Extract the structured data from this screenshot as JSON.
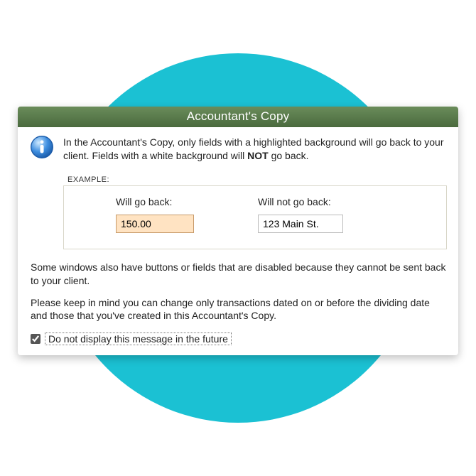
{
  "dialog": {
    "title": "Accountant's Copy",
    "intro_before": "In the Accountant's Copy, only fields with a highlighted background will go back to your client. Fields with a white background will ",
    "intro_bold": "NOT",
    "intro_after": " go back.",
    "example": {
      "label": "EXAMPLE:",
      "will_go_back": {
        "label": "Will go back:",
        "value": "150.00"
      },
      "will_not_go_back": {
        "label": "Will not go back:",
        "value": "123 Main St."
      }
    },
    "para1": "Some windows also have buttons or fields that are disabled because they cannot be sent back to your client.",
    "para2": "Please keep in mind you can change only transactions dated on or before the dividing date and those that you've created in this Accountant's Copy.",
    "checkbox_label": "Do not display this message in the future",
    "checkbox_checked": true,
    "icons": {
      "info": "info-icon"
    },
    "colors": {
      "titlebar": "#597a4a",
      "highlight_bg": "#ffe3c2",
      "circle": "#1bc1d3"
    }
  }
}
